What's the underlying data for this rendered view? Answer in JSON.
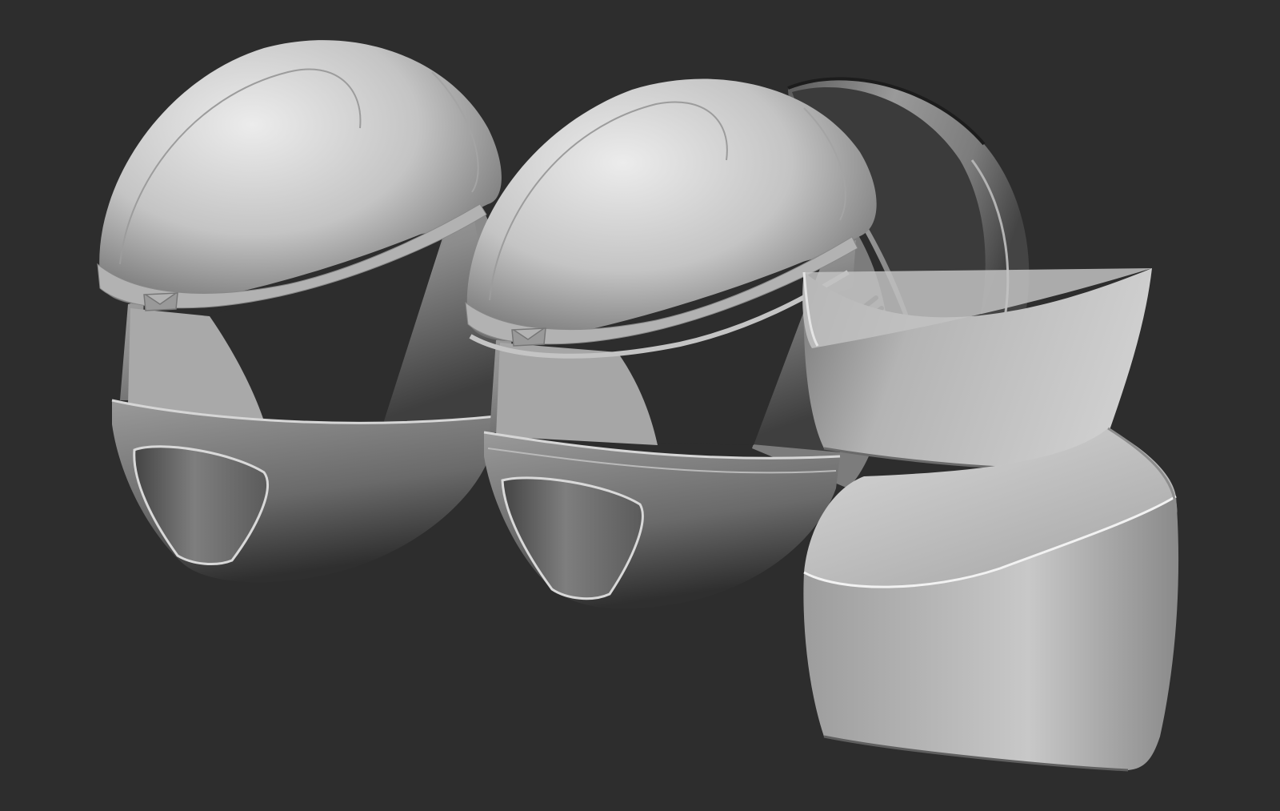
{
  "scene": {
    "background": "#2d2d2d",
    "material": "matcap-grey",
    "objects": [
      {
        "name": "helmet-full"
      },
      {
        "name": "helmet-assembled"
      },
      {
        "name": "helmet-back-shell"
      },
      {
        "name": "helmet-top-fin"
      },
      {
        "name": "helmet-neck-guard"
      }
    ]
  },
  "colors": {
    "background": "#2d2d2d",
    "highlight": "#ececec",
    "mid": "#a6a6a6",
    "shadow": "#3a3a3a",
    "cavity": "#1e1e1e"
  }
}
